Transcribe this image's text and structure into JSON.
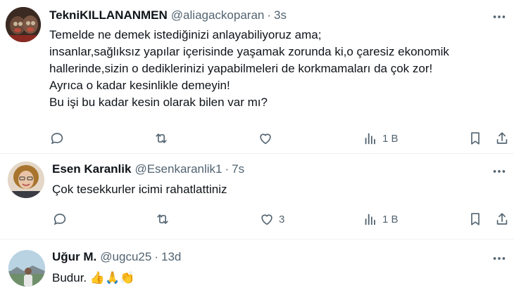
{
  "tweets": [
    {
      "name": "TekniKILLANANMEN",
      "handle": "@aliagackoparan",
      "separator": "·",
      "time": "3s",
      "lines": [
        "Temelde ne demek istediğinizi anlayabiliyoruz ama;",
        "insanlar,sağlıksız yapılar içerisinde yaşamak zorunda ki,o çaresiz ekonomik",
        "hallerinde,sizin o dediklerinizi yapabilmeleri de korkmamaları da çok zor!",
        "Ayrıca o kadar kesinlikle demeyin!",
        "Bu işi bu kadar kesin olarak bilen var mı?"
      ],
      "actions": {
        "reply": "",
        "retweet": "",
        "like": "",
        "views": "1 B"
      }
    },
    {
      "name": "Esen Karanlik",
      "handle": "@Esenkaranlik1",
      "separator": "·",
      "time": "7s",
      "lines": [
        "Çok tesekkurler icimi rahatlattiniz"
      ],
      "actions": {
        "reply": "",
        "retweet": "",
        "like": "3",
        "views": "1 B"
      }
    },
    {
      "name": "Uğur M.",
      "handle": "@ugcu25",
      "separator": "·",
      "time": "13d",
      "text_prefix": "Budur.",
      "emojis": "👍🙏👏"
    }
  ],
  "icons": {
    "more": "more-horizontal-icon",
    "reply": "reply-icon",
    "retweet": "retweet-icon",
    "like": "heart-icon",
    "views": "views-icon",
    "bookmark": "bookmark-icon",
    "share": "share-icon"
  },
  "colors": {
    "text": "#0f1419",
    "secondary": "#536471",
    "divider": "#eff3f4"
  }
}
